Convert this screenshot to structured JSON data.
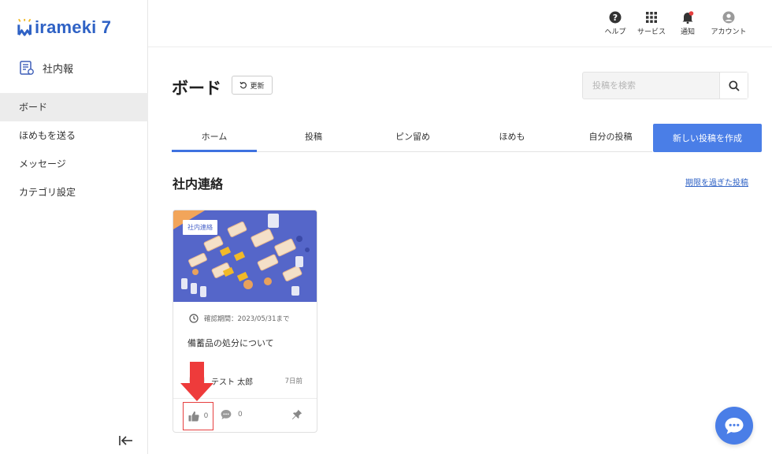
{
  "brand": {
    "name": "irameki 7",
    "accent": "#2f62c5"
  },
  "sidebar": {
    "app_title": "社内報",
    "items": [
      {
        "label": "ボード",
        "active": true
      },
      {
        "label": "ほめもを送る",
        "active": false
      },
      {
        "label": "メッセージ",
        "active": false
      },
      {
        "label": "カテゴリ設定",
        "active": false
      }
    ]
  },
  "topbar": {
    "help": "ヘルプ",
    "services": "サービス",
    "notifications": "通知",
    "account": "アカウント"
  },
  "header": {
    "title": "ボード",
    "refresh_label": "更新",
    "search_placeholder": "投稿を検索"
  },
  "tabs": [
    {
      "label": "ホーム",
      "active": true
    },
    {
      "label": "投稿",
      "active": false
    },
    {
      "label": "ピン留め",
      "active": false
    },
    {
      "label": "ほめも",
      "active": false
    },
    {
      "label": "自分の投稿",
      "active": false
    }
  ],
  "new_post_label": "新しい投稿を作成",
  "section": {
    "title": "社内連絡",
    "expired_link": "期限を過ぎた投稿"
  },
  "card": {
    "badge": "社内連絡",
    "deadline": "確認期間：2023/05/31まで",
    "title": "備蓄品の処分について",
    "author": "テスト 太郎",
    "time": "7日前",
    "likes": "0",
    "comments": "0"
  },
  "colors": {
    "primary": "#4a7ee7",
    "highlight": "#e63f3f"
  }
}
